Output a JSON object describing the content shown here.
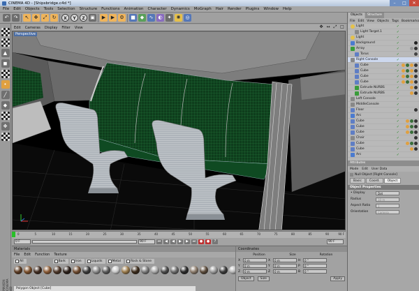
{
  "window": {
    "title": "CINEMA 4D - [Shipsbridge.c4d *]",
    "minimize": "–",
    "maximize": "□",
    "close": "✕"
  },
  "menu": [
    "File",
    "Edit",
    "Objects",
    "Tools",
    "Selection",
    "Structure",
    "Functions",
    "Animation",
    "Character",
    "Dynamics",
    "MoGraph",
    "Hair",
    "Render",
    "Plugins",
    "Window",
    "Help"
  ],
  "toolbar": {
    "undo": "↶",
    "redo": "↷",
    "live": "↖",
    "move": "✥",
    "scale": "⤢",
    "rotate": "↻",
    "x": "X",
    "y": "Y",
    "z": "Z",
    "coord": "▣",
    "render_view": "▶",
    "render_pic": "▶",
    "render_settings": "⚙",
    "cube": "■",
    "nurbs": "◆",
    "spline": "∿",
    "deformer": "◐",
    "scene": "✦",
    "light": "✺",
    "camera": "◎"
  },
  "view_menu": [
    "Edit",
    "Cameras",
    "Display",
    "Filter",
    "View"
  ],
  "viewport": {
    "label": "Perspective",
    "nav": [
      "✥",
      "↔",
      "⤢",
      "□"
    ]
  },
  "timeline": {
    "ticks": [
      "0",
      "5",
      "10",
      "15",
      "20",
      "25",
      "30",
      "35",
      "40",
      "45",
      "50",
      "55",
      "60",
      "65",
      "70",
      "75",
      "80",
      "85",
      "90"
    ],
    "end": "90 F"
  },
  "transport": {
    "start": "0 F",
    "current": "90 F",
    "end": "90 F",
    "buttons": [
      "⏮",
      "◀",
      "◀",
      "▶",
      "▶",
      "⏭",
      "●",
      "●",
      "?"
    ]
  },
  "materials": {
    "title": "Materials",
    "menu": [
      "File",
      "Edit",
      "Function",
      "Texture"
    ],
    "filters": [
      "All",
      "Bark",
      "Iron",
      "Liquids",
      "Metal",
      "Rock & Stone"
    ],
    "status": "Polygon Object [Cube]",
    "ball_colors": [
      "#5a3a22",
      "#7a4e2a",
      "#3e2a1e",
      "#8a5a34",
      "#4a3426",
      "#2a1e18",
      "#6e4a2e",
      "#3a3a3a",
      "#8a8a8a",
      "#5a5a5a",
      "#c8c8c8",
      "#9a7a4a",
      "#3a2a1a",
      "#7a7a7a",
      "#a8a8a8",
      "#4a4a4a",
      "#6a6a6a",
      "#2a2a2a",
      "#8a7a6a",
      "#5a4a3a",
      "#9a9a9a",
      "#3a3a3a",
      "#b8b8b8"
    ]
  },
  "coordinates": {
    "title": "Coordinates",
    "headers": [
      "Position",
      "Size",
      "Rotation"
    ],
    "rows": [
      {
        "axis": "X",
        "pos": "0 m",
        "size": "0 m",
        "rl": "H",
        "rot": "0 °"
      },
      {
        "axis": "Y",
        "pos": "0 m",
        "size": "0 m",
        "rl": "P",
        "rot": "0 °"
      },
      {
        "axis": "Z",
        "pos": "0 m",
        "size": "0 m",
        "rl": "B",
        "rot": "0 °"
      }
    ],
    "mode_object": "Object",
    "mode_size": "Size",
    "apply": "Apply"
  },
  "objects": {
    "tabs": [
      "Objects",
      "Structure"
    ],
    "menu": [
      "File",
      "Edit",
      "View",
      "Objects",
      "Tags",
      "Bookmarks"
    ],
    "items": [
      {
        "name": "Light",
        "indent": 0,
        "icon": "light",
        "color": "#e5c24b",
        "tags": []
      },
      {
        "name": "Light Target.1",
        "indent": 1,
        "icon": "null",
        "color": "#888888",
        "tags": []
      },
      {
        "name": "Light",
        "indent": 0,
        "icon": "light",
        "color": "#e5c24b",
        "tags": []
      },
      {
        "name": "Background",
        "indent": 0,
        "icon": "bg",
        "color": "#4b7bd0",
        "tags": [
          "#222222"
        ]
      },
      {
        "name": "Array",
        "indent": 0,
        "icon": "obj",
        "color": "#3a9c3a",
        "tags": [
          "#999999",
          "#333333"
        ]
      },
      {
        "name": "Torus",
        "indent": 1,
        "icon": "obj",
        "color": "#5f7ec5",
        "tags": [
          "#444444"
        ]
      },
      {
        "name": "Right Console",
        "indent": 0,
        "icon": "null",
        "color": "#888888",
        "tags": [],
        "selected": true
      },
      {
        "name": "Cube",
        "indent": 1,
        "icon": "obj",
        "color": "#5f7ec5",
        "tags": [
          "#e0a040",
          "#3a6e3a",
          "#e0a040",
          "#333333"
        ]
      },
      {
        "name": "Cube",
        "indent": 1,
        "icon": "obj",
        "color": "#5f7ec5",
        "tags": [
          "#e0a040",
          "#3a6e3a",
          "#e0a040",
          "#333333"
        ]
      },
      {
        "name": "Cube",
        "indent": 1,
        "icon": "obj",
        "color": "#5f7ec5",
        "tags": [
          "#e0a040",
          "#3a6e3a",
          "#e0a040",
          "#333333"
        ]
      },
      {
        "name": "Cube",
        "indent": 1,
        "icon": "obj",
        "color": "#5f7ec5",
        "tags": [
          "#e0a040",
          "#3a6e3a",
          "#e0a040",
          "#333333"
        ]
      },
      {
        "name": "Extrude NURBS",
        "indent": 1,
        "icon": "obj",
        "color": "#3a9c3a",
        "tags": [
          "#e0a040",
          "#333333"
        ]
      },
      {
        "name": "Extrude NURBS",
        "indent": 1,
        "icon": "obj",
        "color": "#3a9c3a",
        "tags": [
          "#e0a040",
          "#333333"
        ]
      },
      {
        "name": "Left Console",
        "indent": 0,
        "icon": "null",
        "color": "#888888",
        "tags": []
      },
      {
        "name": "MiddleConsole",
        "indent": 0,
        "icon": "null",
        "color": "#888888",
        "tags": []
      },
      {
        "name": "Floor",
        "indent": 0,
        "icon": "obj",
        "color": "#5f7ec5",
        "tags": [
          "#333333"
        ]
      },
      {
        "name": "Arc",
        "indent": 0,
        "icon": "spline",
        "color": "#4b7bd0",
        "tags": []
      },
      {
        "name": "Cube",
        "indent": 0,
        "icon": "obj",
        "color": "#5f7ec5",
        "tags": [
          "#e0a040",
          "#3a6e3a",
          "#333333"
        ]
      },
      {
        "name": "Cube",
        "indent": 0,
        "icon": "obj",
        "color": "#5f7ec5",
        "tags": [
          "#e0a040",
          "#3a6e3a",
          "#333333"
        ]
      },
      {
        "name": "Cube",
        "indent": 0,
        "icon": "obj",
        "color": "#5f7ec5",
        "tags": [
          "#e0a040",
          "#3a6e3a",
          "#333333"
        ]
      },
      {
        "name": "Chair",
        "indent": 0,
        "icon": "null",
        "color": "#888888",
        "tags": [
          "#333333"
        ]
      },
      {
        "name": "Cube",
        "indent": 0,
        "icon": "obj",
        "color": "#5f7ec5",
        "tags": [
          "#e0a040",
          "#3a6e3a",
          "#333333"
        ]
      },
      {
        "name": "Cube",
        "indent": 0,
        "icon": "obj",
        "color": "#5f7ec5",
        "tags": [
          "#e0a040",
          "#333333"
        ]
      },
      {
        "name": "Arc",
        "indent": 0,
        "icon": "spline",
        "color": "#4b7bd0",
        "tags": []
      }
    ]
  },
  "attributes": {
    "title": "Attributes",
    "menu": [
      "Mode",
      "Edit",
      "User Data"
    ],
    "object_label": "Null Object [Right Console]",
    "tabs": [
      "Basic",
      "Coord.",
      "Object"
    ],
    "section": "Object Properties",
    "props": [
      {
        "label": "• Display",
        "value": "Dot",
        "dim": false
      },
      {
        "label": "Radius",
        "value": "10 m",
        "dim": true
      },
      {
        "label": "Aspect Ratio",
        "value": "1",
        "dim": true
      },
      {
        "label": "Orientation",
        "value": "Camera",
        "dim": true
      }
    ]
  },
  "side_label": "MAXON CINEMA 4D"
}
